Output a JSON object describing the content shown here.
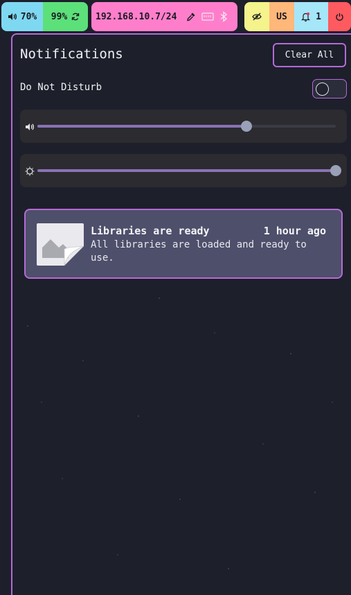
{
  "topbar": {
    "volume": {
      "icon": "speaker-icon",
      "value": "70%",
      "bg": "#7fd8f2"
    },
    "battery": {
      "value": "99%",
      "icon": "sync-icon",
      "bg": "#5ce07a"
    },
    "network": {
      "ip": "192.168.10.7/24",
      "icons": [
        "eyedropper-icon",
        "ethernet-icon",
        "bluetooth-icon"
      ],
      "bg": "#ff7ecb"
    },
    "privacy": {
      "icon": "eye-off-icon",
      "bg": "#f4f38c"
    },
    "keyboard": {
      "layout": "US",
      "bg": "#ffb77a"
    },
    "notifications": {
      "icon": "bell-icon",
      "count": "1",
      "bg": "#a5e6f9"
    },
    "power": {
      "icon": "power-icon",
      "bg": "#ff5a5f"
    }
  },
  "panel": {
    "title": "Notifications",
    "clear_label": "Clear All",
    "dnd_label": "Do Not Disturb",
    "dnd_enabled": false,
    "accent": "#b56ad8"
  },
  "sliders": {
    "volume": {
      "icon": "speaker-icon",
      "level": 0.7
    },
    "brightness": {
      "icon": "sun-icon",
      "level": 1.0
    }
  },
  "notifications": [
    {
      "icon": "image-placeholder-icon",
      "title": "Libraries are ready",
      "time": "1 hour ago",
      "body": "All libraries are loaded and ready to use."
    }
  ]
}
